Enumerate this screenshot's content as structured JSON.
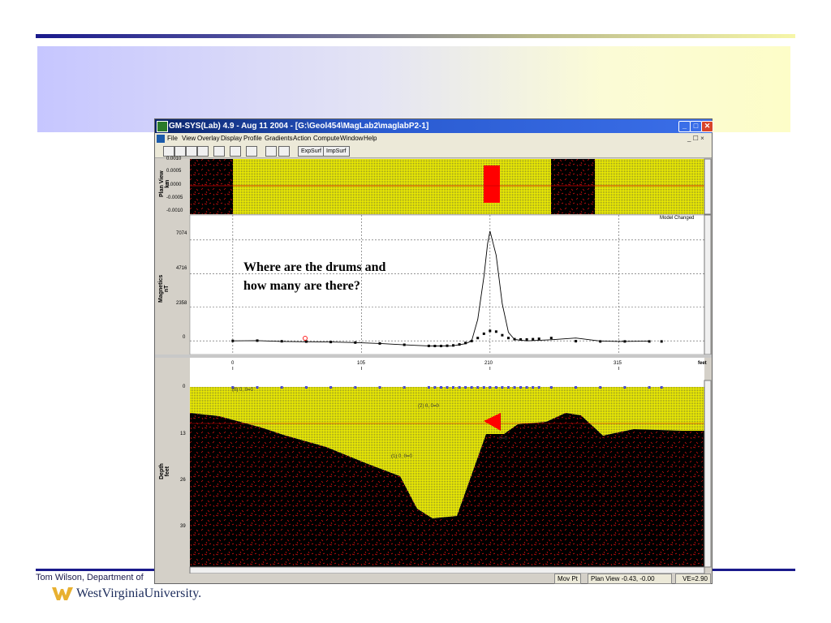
{
  "slide": {
    "footer_text": "Tom Wilson, Department of",
    "logo_text": "WestVirginiaUniversity."
  },
  "app": {
    "title": "GM-SYS(Lab) 4.9 - Aug 11 2004 - [G:\\Geol454\\MagLab2\\maglabP2-1]",
    "menu": [
      "File",
      "View",
      "Overlay",
      "Display",
      "Profile",
      "Gradients",
      "Action",
      "Compute",
      "Window",
      "Help"
    ],
    "toolbar_buttons": [
      "ExpSurf",
      "ImpSurf"
    ],
    "window_buttons": {
      "minimize": "_",
      "maximize": "□",
      "close": "✕"
    },
    "mdi_controls": "_ ☐ ×"
  },
  "plan_view": {
    "label": "Plan View\nkm",
    "ticks": [
      "0.0010",
      "0.0005",
      "0.0000",
      "-0.0005",
      "-0.0010"
    ]
  },
  "magnetics": {
    "label": "Magnetics\nnT",
    "ticks": [
      "7074",
      "4716",
      "2358",
      "0"
    ],
    "status": "Model Changed",
    "annotation_line1": "Where are the drums and",
    "annotation_line2": "how many are there?"
  },
  "x_axis": {
    "ticks": [
      "0",
      "105",
      "210",
      "315"
    ],
    "unit": "feet"
  },
  "depth": {
    "label": "Depth\nfeet",
    "ticks": [
      "0",
      "13",
      "26",
      "39"
    ],
    "labels": [
      "(0) 0, 0=0",
      "(2) 0, 0=0",
      "(1) 0, 0=0",
      "0=0"
    ]
  },
  "status": {
    "mode": "Mov Pt",
    "coords": "Plan View -0.43, -0.00",
    "ve": "VE=2.90"
  },
  "chart_data": {
    "type": "line",
    "xlabel": "feet",
    "ylabel": "Magnetics nT",
    "xlim": [
      -35,
      385
    ],
    "ylim": [
      -500,
      8600
    ],
    "series": [
      {
        "style": "line",
        "x": [
          0,
          20,
          40,
          60,
          80,
          100,
          120,
          140,
          160,
          170,
          180,
          190,
          195,
          200,
          205,
          208,
          210,
          215,
          220,
          225,
          230,
          240,
          260,
          280,
          300,
          315,
          340
        ],
        "y": [
          0,
          20,
          -40,
          -60,
          -80,
          -120,
          -180,
          -280,
          -350,
          -360,
          -340,
          -200,
          0,
          1500,
          4500,
          6800,
          7700,
          6000,
          2600,
          600,
          100,
          0,
          80,
          200,
          -10,
          -40,
          -20
        ]
      },
      {
        "style": "points",
        "x": [
          0,
          20,
          40,
          60,
          80,
          100,
          120,
          140,
          160,
          165,
          170,
          175,
          180,
          185,
          190,
          195,
          200,
          205,
          210,
          215,
          220,
          225,
          230,
          235,
          240,
          245,
          250,
          260,
          280,
          300,
          320,
          340,
          350
        ],
        "y": [
          0,
          20,
          -30,
          -50,
          -80,
          -120,
          -180,
          -270,
          -350,
          -360,
          -360,
          -340,
          -320,
          -250,
          -150,
          -10,
          200,
          500,
          700,
          650,
          400,
          200,
          120,
          100,
          100,
          120,
          150,
          200,
          -20,
          -40,
          -40,
          -40,
          -40
        ]
      }
    ]
  }
}
